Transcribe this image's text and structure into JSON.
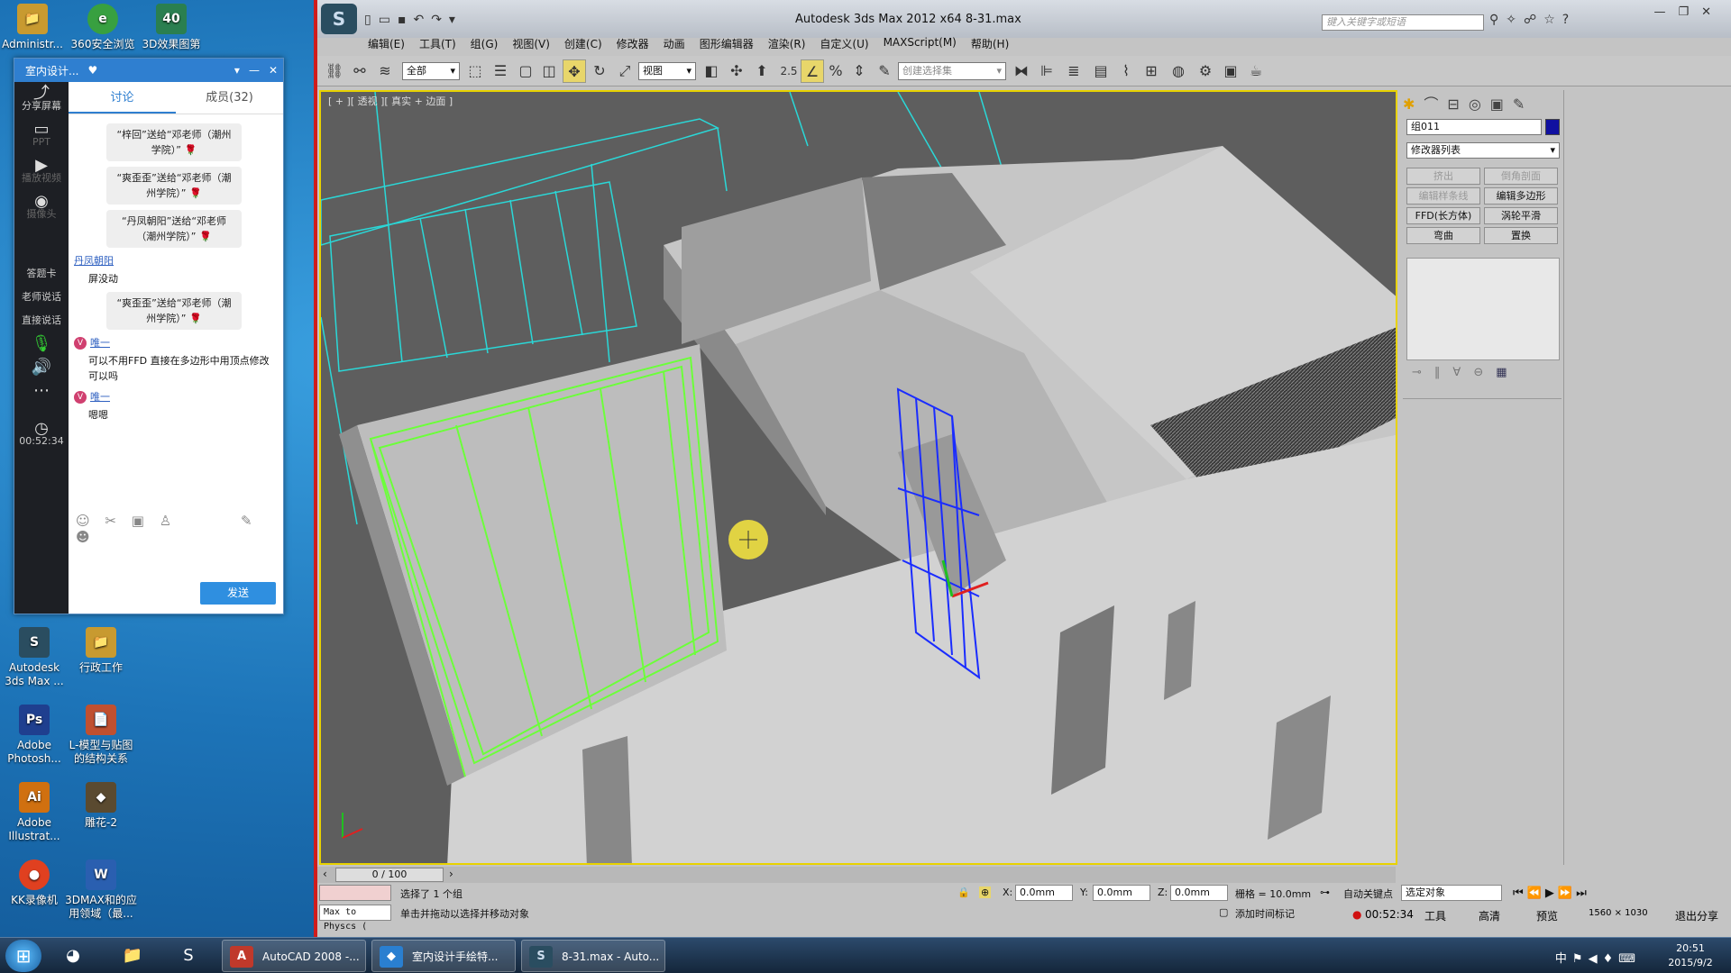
{
  "desktop": {
    "icons": [
      {
        "label": "Administr...",
        "glyph": "📁",
        "color": "#c89a30"
      },
      {
        "label": "360安全浏览",
        "glyph": "e",
        "color": "#38a040"
      },
      {
        "label": "3D效果图第",
        "glyph": "40",
        "color": "#2a7f50"
      },
      {
        "label": "Autodesk 3ds Max ...",
        "glyph": "S",
        "color": "#2a4d60"
      },
      {
        "label": "行政工作",
        "glyph": "📁",
        "color": "#c89a30"
      },
      {
        "label": "Adobe Photosh...",
        "glyph": "Ps",
        "color": "#1f3f8f"
      },
      {
        "label": "L-模型与贴图的结构关系",
        "glyph": "📄",
        "color": "#c05030"
      },
      {
        "label": "Adobe Illustrat...",
        "glyph": "Ai",
        "color": "#d07010"
      },
      {
        "label": "雕花-2",
        "glyph": "◆",
        "color": "#5a4a30"
      },
      {
        "label": "KK录像机",
        "glyph": "●",
        "color": "#e04020"
      },
      {
        "label": "3DMAX和的应用领域（最...",
        "glyph": "W",
        "color": "#2a5fb0"
      }
    ]
  },
  "chat": {
    "title": "室内设计...",
    "tabs": [
      "讨论",
      "成员(32)"
    ],
    "side_items": [
      "分享屏幕",
      "PPT",
      "播放视频",
      "摄像头",
      "答题卡",
      "老师说话",
      "直接说话",
      "00:52:34"
    ],
    "gifts": [
      "“梓回”送给“邓老师（潮州学院）”",
      "“爽歪歪”送给“邓老师（潮州学院）”",
      "“丹凤朝阳”送给“邓老师（潮州学院）”"
    ],
    "user1": "丹凤朝阳",
    "msg1": "屏没动",
    "gift4": "“爽歪歪”送给“邓老师（潮州学院）”",
    "user2": "唯一",
    "msg2": "可以不用FFD  直接在多边形中用顶点修改可以吗",
    "user3": "唯一",
    "msg3": "嗯嗯",
    "send": "发送"
  },
  "max": {
    "title": "Autodesk 3ds Max  2012 x64        8-31.max",
    "search_placeholder": "键入关键字或短语",
    "menus": [
      "编辑(E)",
      "工具(T)",
      "组(G)",
      "视图(V)",
      "创建(C)",
      "修改器",
      "动画",
      "图形编辑器",
      "渲染(R)",
      "自定义(U)",
      "MAXScript(M)",
      "帮助(H)"
    ],
    "filter_select": "全部",
    "ref_select": "视图",
    "snap_label": "2.5",
    "named_sel": "创建选择集",
    "viewport_label": "[ + ][ 透视 ][ 真实 + 边面 ]",
    "object_name": "组011",
    "modifier_list": "修改器列表",
    "mod_buttons": [
      {
        "label": "挤出",
        "disabled": true
      },
      {
        "label": "倒角剖面",
        "disabled": true
      },
      {
        "label": "编辑样条线",
        "disabled": true
      },
      {
        "label": "编辑多边形",
        "disabled": false
      },
      {
        "label": "FFD(长方体)",
        "disabled": false
      },
      {
        "label": "涡轮平滑",
        "disabled": false
      },
      {
        "label": "弯曲",
        "disabled": false
      },
      {
        "label": "置换",
        "disabled": false
      }
    ],
    "time_slider": "0 / 100",
    "status_selected": "选择了 1 个组",
    "status_prompt": "单击并拖动以选择并移动对象",
    "maxscript_field": "Max to Physcs (",
    "x_value": "0.0mm",
    "y_value": "0.0mm",
    "z_value": "0.0mm",
    "grid": "栅格 = 10.0mm",
    "add_time_tag": "添加时间标记",
    "auto_key": "自动关键点",
    "set_key": "选定对象"
  },
  "overlay": {
    "rec_time": "00:52:34",
    "tools": "工具",
    "quality": "高清",
    "preview": "预览",
    "res": "1560 × 1030",
    "exit": "退出分享"
  },
  "taskbar": {
    "apps": [
      "AutoCAD 2008 -...",
      "室内设计手绘特...",
      "8-31.max - Auto..."
    ],
    "time": "20:51",
    "date": "2015/9/2",
    "ime": "中"
  }
}
